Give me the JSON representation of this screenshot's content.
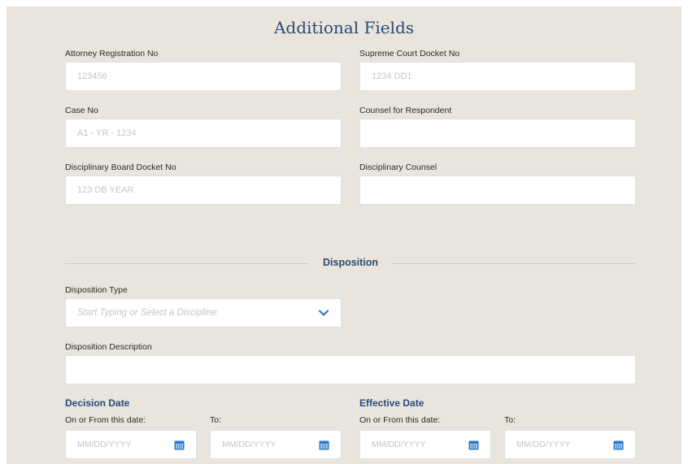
{
  "form": {
    "title": "Additional Fields",
    "fields": {
      "attorney_reg": {
        "label": "Attorney Registration No",
        "placeholder": "123456"
      },
      "supreme_docket": {
        "label": "Supreme Court Docket No",
        "placeholder": "1234 DD1"
      },
      "case_no": {
        "label": "Case No",
        "placeholder": "A1 - YR - 1234"
      },
      "counsel_respondent": {
        "label": "Counsel for Respondent",
        "placeholder": ""
      },
      "board_docket": {
        "label": "Disciplinary Board Docket No",
        "placeholder": "123 DB YEAR"
      },
      "disc_counsel": {
        "label": "Disciplinary Counsel",
        "placeholder": ""
      }
    }
  },
  "disposition": {
    "section_title": "Disposition",
    "type_label": "Disposition Type",
    "type_placeholder": "Start Typing or Select a Discipline",
    "description_label": "Disposition Description",
    "description_placeholder": ""
  },
  "decision_date": {
    "title": "Decision Date",
    "from_label": "On or From this date:",
    "to_label": "To:",
    "from_placeholder": "MM/DD/YYYY",
    "to_placeholder": "MM/DD/YYYY"
  },
  "effective_date": {
    "title": "Effective Date",
    "from_label": "On or From this date:",
    "to_label": "To:",
    "from_placeholder": "MM/DD/YYYY",
    "to_placeholder": "MM/DD/YYYY"
  },
  "icons": {
    "chevron": "chevron-down-icon",
    "calendar": "calendar-icon"
  },
  "colors": {
    "accent": "#274a77",
    "panel_bg": "#e9e5dc",
    "icon": "#2a78c8"
  }
}
